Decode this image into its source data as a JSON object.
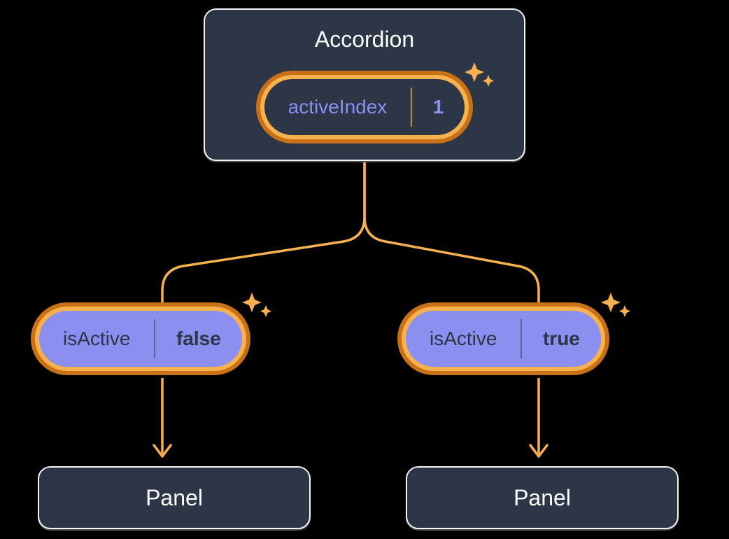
{
  "accordion": {
    "title": "Accordion",
    "pill": {
      "label": "activeIndex",
      "value": "1"
    }
  },
  "children": [
    {
      "pill": {
        "label": "isActive",
        "value": "false"
      },
      "panel": {
        "title": "Panel"
      }
    },
    {
      "pill": {
        "label": "isActive",
        "value": "true"
      },
      "panel": {
        "title": "Panel"
      }
    }
  ],
  "colors": {
    "accent": "#f7b14f",
    "accent_dark": "#c97117",
    "node_bg": "#2c3647",
    "pill_light": "#8b8ff0"
  }
}
